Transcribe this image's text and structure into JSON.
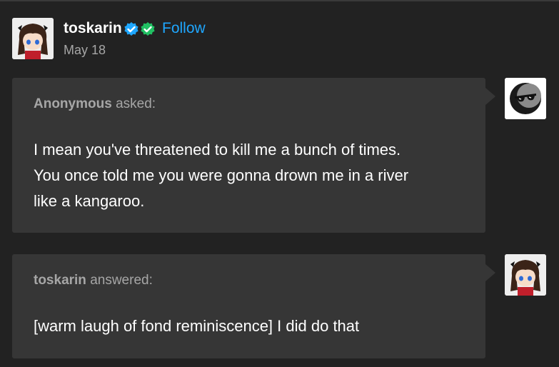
{
  "post": {
    "author": "toskarin",
    "follow_label": "Follow",
    "date": "May 18",
    "badges": [
      "verified-blue-badge-icon",
      "verified-green-badge-icon"
    ],
    "accent_color": "#1fa7ff",
    "green_badge_color": "#21c063"
  },
  "ask": {
    "asker": "Anonymous",
    "asked_label": "asked:",
    "lines": [
      "I mean you've threatened to kill me a bunch of times.",
      "You once told me you were gonna drown me in a river",
      "like a kangaroo."
    ]
  },
  "answer": {
    "answerer": "toskarin",
    "answered_label": "answered:",
    "text": "[warm laugh of fond reminiscence] I did do that"
  }
}
